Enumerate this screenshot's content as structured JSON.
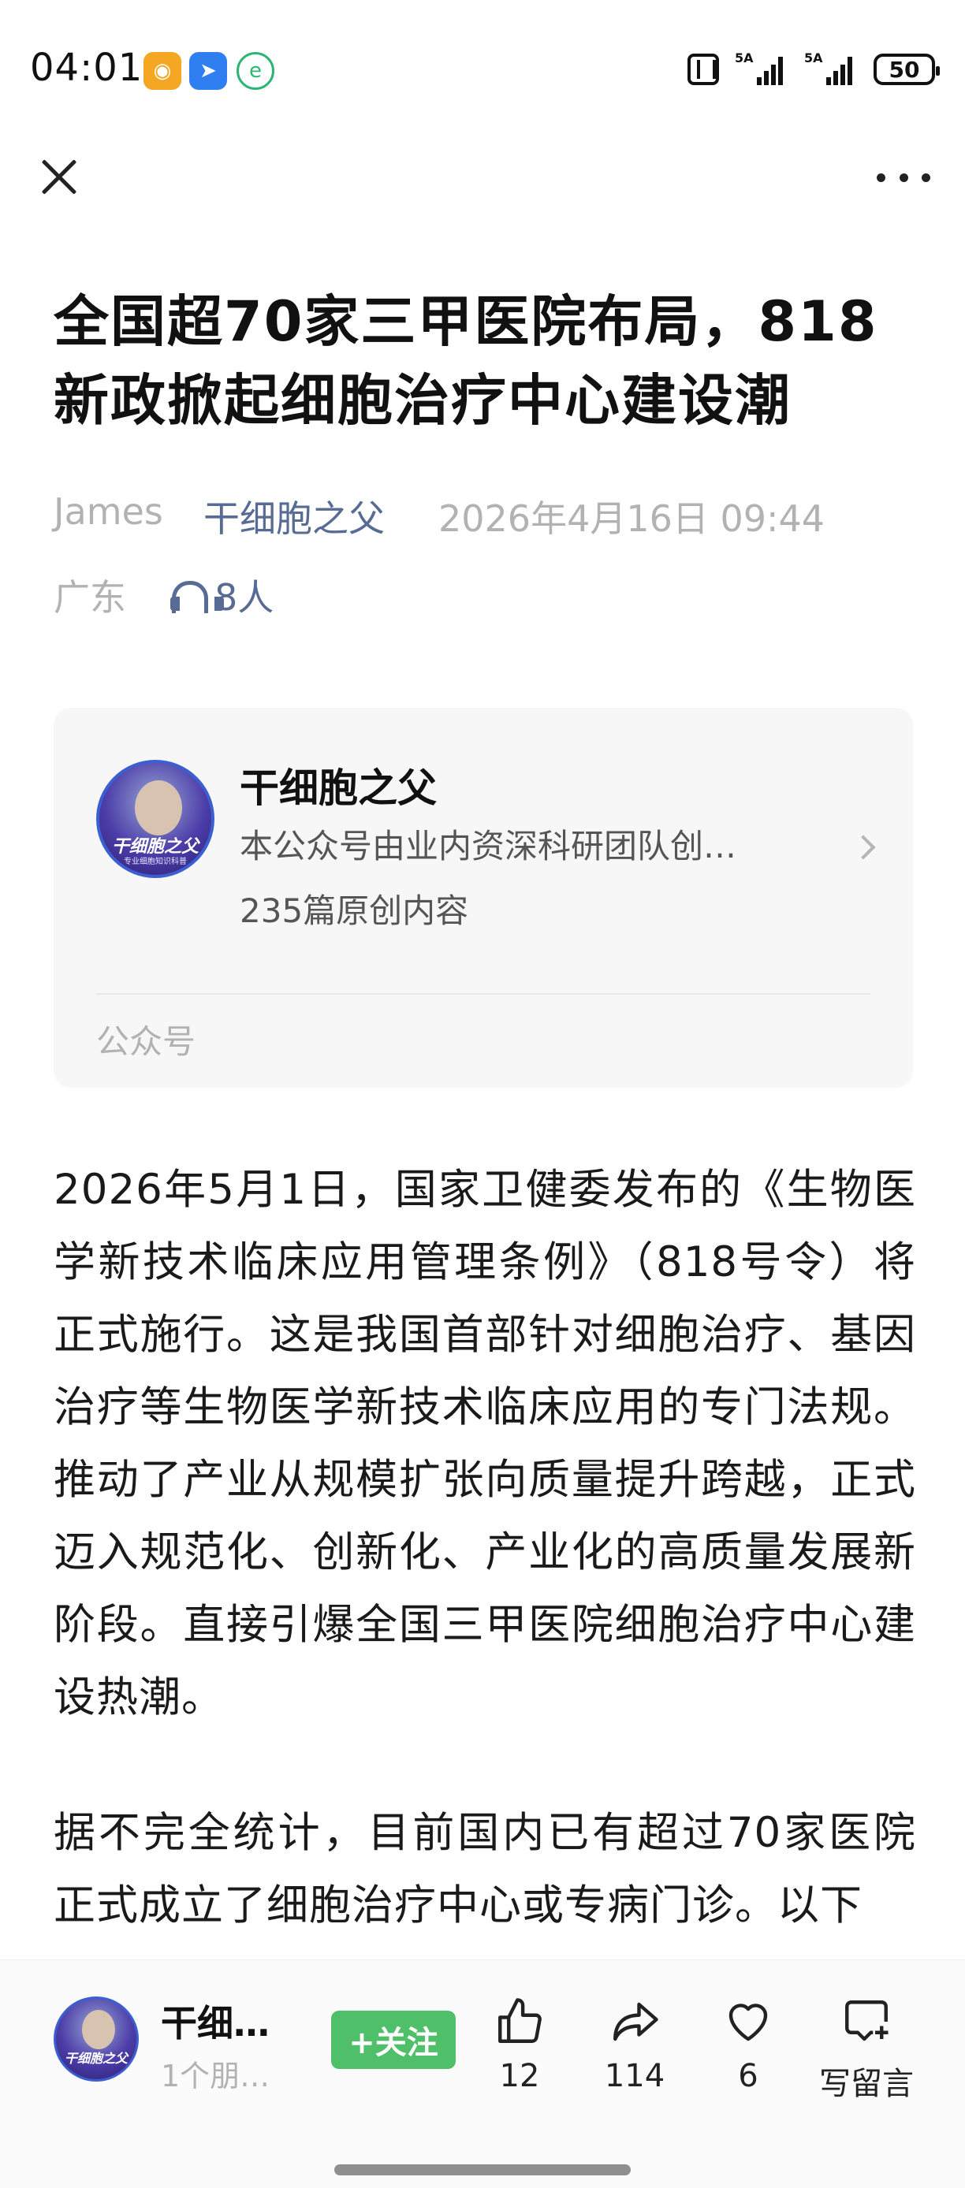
{
  "status_bar": {
    "time": "04:01",
    "battery": "50",
    "signal1_tag": "5A",
    "signal2_tag": "5A"
  },
  "article": {
    "title": "全国超70家三甲医院布局，818新政掀起细胞治疗中心建设潮",
    "author": "James",
    "account": "干细胞之父",
    "date": "2026年4月16日 09:44",
    "region": "广东",
    "listeners": "8人"
  },
  "profile_card": {
    "name": "干细胞之父",
    "description": "本公众号由业内资深科研团队创…",
    "count": "235篇原创内容",
    "type": "公众号",
    "avatar_text": "干细胞之父",
    "avatar_subtext": "专业细胞知识科普"
  },
  "body": {
    "paragraph1": "2026年5月1日，国家卫健委发布的《生物医学新技术临床应用管理条例》（818号令）将正式施行。这是我国首部针对细胞治疗、基因治疗等生物医学新技术临床应用的专门法规。推动了产业从规模扩张向质量提升跨越，正式迈入规范化、创新化、产业化的高质量发展新阶段。直接引爆全国三甲医院细胞治疗中心建设热潮。",
    "paragraph2": "据不完全统计，目前国内已有超过70家医院正式成立了细胞治疗中心或专病门诊。以下"
  },
  "bottom_bar": {
    "name": "干细…",
    "friends": "1个朋…",
    "follow_label": "+关注",
    "like_count": "12",
    "share_count": "114",
    "heart_count": "6",
    "comment_label": "写留言"
  },
  "colors": {
    "link": "#576b95",
    "follow": "#4fbf6a",
    "meta": "#b2b2b2"
  }
}
